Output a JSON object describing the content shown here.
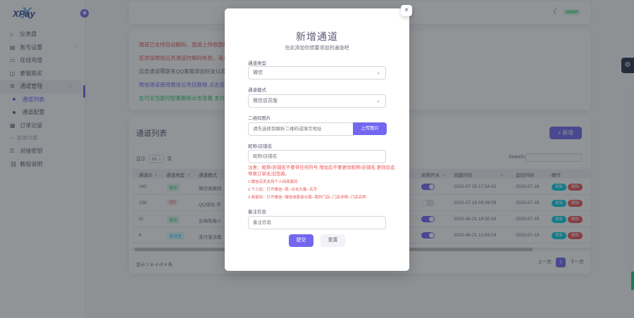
{
  "app": {
    "logo": "XPay",
    "logo_mark": "X"
  },
  "sidebar": {
    "items": [
      {
        "icon": "home-icon",
        "glyph": "⌂",
        "label": "仪表盘"
      },
      {
        "icon": "book-icon",
        "glyph": "▤",
        "label": "账号设置",
        "chevron": "›"
      },
      {
        "icon": "card-icon",
        "glyph": "▭",
        "label": "在线充值"
      },
      {
        "icon": "cart-icon",
        "glyph": "◫",
        "label": "套餐购买"
      },
      {
        "icon": "gear-icon",
        "glyph": "⚙",
        "label": "通道管理",
        "chevron": "⌄"
      }
    ],
    "subitems": [
      {
        "label": "通道列表",
        "active": true
      },
      {
        "label": "通道配置",
        "active": false
      }
    ],
    "orders": {
      "icon": "receipt-icon",
      "glyph": "▦",
      "label": "订单记录"
    },
    "section": "其他功能",
    "other": [
      {
        "icon": "key-icon",
        "glyph": "⚿",
        "label": "对接密钥"
      },
      {
        "icon": "link-icon",
        "glyph": "⛓",
        "label": "教程说明"
      }
    ]
  },
  "navbar": {
    "theme_icon": "☾",
    "user_badge": "ABBR"
  },
  "notice": {
    "lines": [
      {
        "text": "通道已支持自动解码，直接上传收款码即可",
        "color": "#ea5455"
      },
      {
        "text": "若添加微信店员通道时解码失败，请点击",
        "color": "#ea5455"
      },
      {
        "text": "店员通道需联系QQ客服添加好友以及绑定",
        "color": "#6e6b7b"
      },
      {
        "text": "微信通道使用微信云免挂教程 点击查看",
        "color": "#7367f0"
      },
      {
        "text": "支付宝当面付配置教程点击查看  支付宝",
        "color": "#28c76f"
      }
    ]
  },
  "table": {
    "title": "通道列表",
    "add_label": "+ 新增",
    "show_prefix": "显示",
    "show_value": "10 ⌄",
    "show_suffix": "条",
    "search_label": "Search:",
    "headers": [
      "通道ID",
      "通道类型",
      "通道模式",
      "启用开关",
      "创建时间",
      "监控时间",
      "操作"
    ],
    "rows": [
      {
        "id": "169",
        "type": "微信",
        "type_color": "#28c76f",
        "type_bg": "#e5f8ed",
        "mode": "微信收款码",
        "on": true,
        "created": "2023-07-28 17:54:32",
        "monitor": "2023-07-28"
      },
      {
        "id": "158",
        "type": "QQ",
        "type_color": "#ea5455",
        "type_bg": "#fceaea",
        "mode": "QQ钱包-手",
        "on": false,
        "created": "2023-07-18 09:28:09",
        "monitor": "2023-07-29"
      },
      {
        "id": "11",
        "type": "微信",
        "type_color": "#28c76f",
        "type_bg": "#e5f8ed",
        "mode": "云端免输入",
        "on": true,
        "created": "2023-06-21 19:30:33",
        "monitor": "2023-07-29"
      },
      {
        "id": "4",
        "type": "支付宝",
        "type_color": "#00cfe8",
        "type_bg": "#e0f9fc",
        "mode": "支付宝当面",
        "on": true,
        "created": "2023-06-21 12:43:04",
        "monitor": "2023-07-19"
      }
    ],
    "edit_label": "更新",
    "delete_label": "删除",
    "info": "显示 1 to 4 of 4 条",
    "prev": "上一页",
    "page": "1",
    "next": "下一页"
  },
  "modal": {
    "close": "×",
    "title": "新增通道",
    "subtitle": "在此添加你想要添加的通道吧",
    "channel_label": "通道类型",
    "channel_value": "微信",
    "mode_label": "通道模式",
    "mode_value": "微信店员版",
    "qr_label": "二维码图片",
    "qr_placeholder": "请先选择到解析二维码或填写地址",
    "upload_label": "上传图片",
    "name_label": "昵称/店铺名",
    "name_placeholder": "昵称/店铺名",
    "warn_main": "注意：昵称/店铺名不要带任何符号,增加后不要更改昵称/店铺名,更改后会导致订单无法回调。",
    "warn_1": "1.微信店员支持个人码商家码",
    "warn_2": "2.个人码：打开微信--我--点击头像--名字",
    "warn_3": "3.商家码：打开微信--微信收款商业版--我的门店--门店详情--门店名称",
    "remark_label": "备注信息",
    "remark_placeholder": "备注信息",
    "submit": "提交",
    "reset": "重置"
  },
  "colors": {
    "primary": "#7367f0",
    "danger": "#ea5455",
    "success": "#28c76f",
    "info": "#00cfe8"
  }
}
